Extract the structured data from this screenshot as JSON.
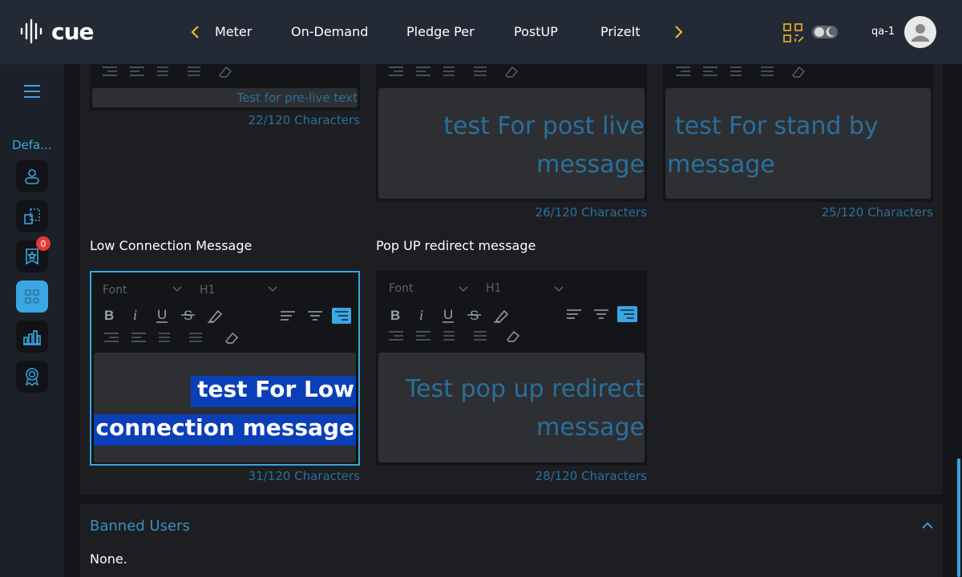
{
  "app": {
    "logo_text": "cue",
    "username": "qa-1"
  },
  "nav": {
    "items": [
      "Meter",
      "On-Demand",
      "Pledge Per",
      "PostUP",
      "PrizeIt"
    ]
  },
  "sidebar": {
    "section_label": "Defa...",
    "badge_count": "0"
  },
  "editors": {
    "prelive": {
      "text": "Test for pre-live text",
      "count": "22/120 Characters"
    },
    "postlive": {
      "text_line1": "test For post live",
      "text_line2": "message",
      "count": "26/120 Characters"
    },
    "standby": {
      "text_line1": "test For stand by",
      "text_line2": "message",
      "count": "25/120 Characters"
    },
    "lowconn": {
      "label": "Low Connection Message",
      "font": "Font",
      "heading": "H1",
      "text_line1": "test For Low",
      "text_line2": "connection message",
      "count": "31/120 Characters"
    },
    "popup": {
      "label": "Pop UP redirect message",
      "font": "Font",
      "heading": "H1",
      "text_line1": "Test pop up redirect",
      "text_line2": "message",
      "count": "28/120 Characters"
    }
  },
  "banned": {
    "title": "Banned Users",
    "body": "None."
  },
  "colors": {
    "accent": "#3aa6e2",
    "topbar": "#232a36",
    "highlight": "#0a3fb8",
    "badge": "#e53935",
    "qr": "#f0b429"
  }
}
